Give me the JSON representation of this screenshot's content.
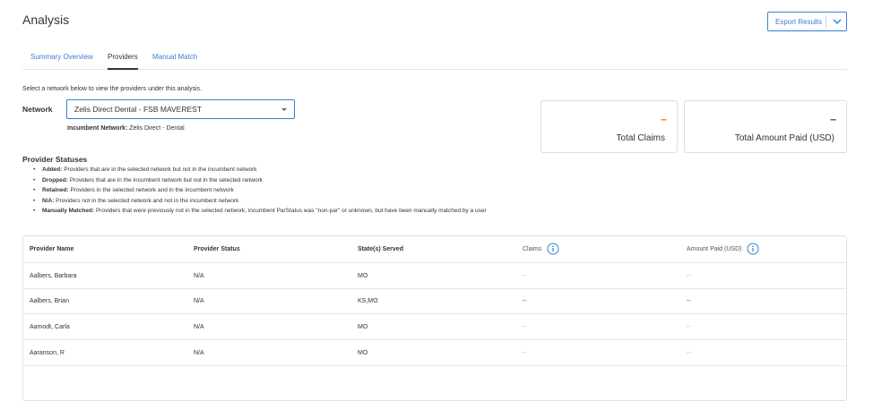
{
  "header": {
    "title": "Analysis",
    "export_label": "Export Results"
  },
  "tabs": [
    {
      "label": "Summary Overview",
      "active": false
    },
    {
      "label": "Providers",
      "active": true
    },
    {
      "label": "Manual Match",
      "active": false
    }
  ],
  "network": {
    "instructions": "Select a network below to view the providers under this analysis.",
    "label": "Network",
    "selected": "Zelis Direct Dental - FSB MAVEREST",
    "incumbent_label": "Incumbent Network:",
    "incumbent_value": "Zelis Direct - Dental"
  },
  "stats": [
    {
      "value": "--",
      "label": "Total Claims",
      "color": "#e8843a"
    },
    {
      "value": "--",
      "label": "Total Amount Paid (USD)",
      "color": "#7a3d8f"
    }
  ],
  "statuses": {
    "title": "Provider Statuses",
    "items": [
      {
        "term": "Added:",
        "desc": "Providers that are in the selected network but not in the incumbent network"
      },
      {
        "term": "Dropped:",
        "desc": "Providers that are in the incumbent network but not in the selected network"
      },
      {
        "term": "Retained:",
        "desc": "Providers in the selected network and in the incumbent network"
      },
      {
        "term": "N/A:",
        "desc": "Providers not in the selected network and not in the incumbent network"
      },
      {
        "term": "Manually Matched:",
        "desc": "Providers that were previously not in the selected network, incumbent ParStatus was \"non-par\" or unknown, but have been manually matched by a user"
      }
    ]
  },
  "table": {
    "columns": [
      "Provider Name",
      "Provider Status",
      "State(s) Served",
      "Claims",
      "Amount Paid (USD)"
    ],
    "rows": [
      {
        "name": "Aalbers, Barbara",
        "status": "N/A",
        "states": "MO",
        "claims": "--",
        "amount": "--"
      },
      {
        "name": "Aalbers, Brian",
        "status": "N/A",
        "states": "KS,MO",
        "claims": "--",
        "amount": "--"
      },
      {
        "name": "Aamodt, Carla",
        "status": "N/A",
        "states": "MO",
        "claims": "--",
        "amount": "--"
      },
      {
        "name": "Aaranson, R",
        "status": "N/A",
        "states": "MO",
        "claims": "--",
        "amount": "--"
      }
    ]
  },
  "colors": {
    "accent": "#3b7ed6",
    "claims_dash": "#e8843a",
    "amount_dash": "#7a3d8f"
  }
}
